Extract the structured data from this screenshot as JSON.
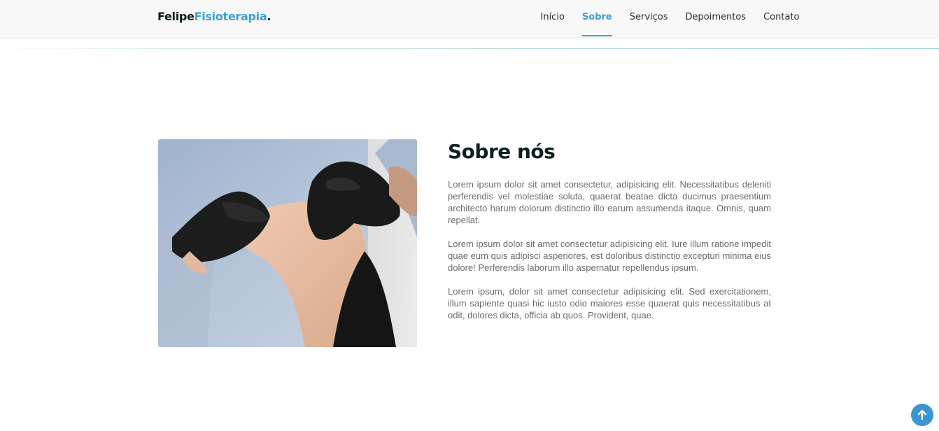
{
  "header": {
    "logo": {
      "part1": "Felipe",
      "part2": "Fisioterapia",
      "part3": "."
    },
    "nav": [
      {
        "label": "Início",
        "active": false
      },
      {
        "label": "Sobre",
        "active": true
      },
      {
        "label": "Serviços",
        "active": false
      },
      {
        "label": "Depoimentos",
        "active": false
      },
      {
        "label": "Contato",
        "active": false
      }
    ]
  },
  "about": {
    "title": "Sobre nós",
    "paragraphs": [
      "Lorem ipsum dolor sit amet consectetur, adipisicing elit. Necessitatibus deleniti perferendis vel molestiae soluta, quaerat beatae dicta ducimus praesentium architecto harum dolorum distinctio illo earum assumenda itaque. Omnis, quam repellat.",
      "Lorem ipsum dolor sit amet consectetur adipisicing elit. Iure illum ratione impedit quae eum quis adipisci asperiores, est doloribus distinctio excepturi minima eius dolore! Perferendis laborum illo aspernatur repellendus ipsum.",
      "Lorem ipsum, dolor sit amet consectetur adipisicing elit. Sed exercitationem, illum sapiente quasi hic iusto odio maiores esse quaerat quis necessitatibus at odit, dolores dicta, officia ab quos. Provident, quae."
    ],
    "image_icon": "physiotherapy-foot-photo"
  },
  "back_to_top": {
    "icon": "arrow-up-icon"
  },
  "colors": {
    "accent": "#3aa0d6",
    "dark": "#0f1f1f",
    "text": "#6a6a6a",
    "header_bg": "#f8f8f8"
  }
}
